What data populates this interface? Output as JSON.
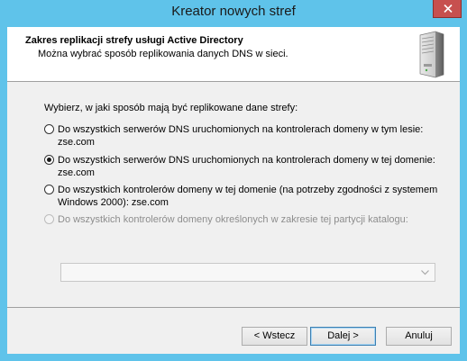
{
  "window": {
    "title": "Kreator nowych stref"
  },
  "header": {
    "title": "Zakres replikacji strefy usługi Active Directory",
    "subtitle": "Można wybrać sposób replikowania danych DNS w sieci."
  },
  "body": {
    "prompt": "Wybierz, w jaki sposób mają być replikowane dane strefy:",
    "options": [
      {
        "line1": "Do wszystkich serwerów DNS uruchomionych na kontrolerach domeny w tym lesie:",
        "line2": "zse.com",
        "selected": false,
        "disabled": false
      },
      {
        "line1": "Do wszystkich serwerów DNS uruchomionych na kontrolerach domeny w tej domenie:",
        "line2": "zse.com",
        "selected": true,
        "disabled": false
      },
      {
        "line1": "Do wszystkich kontrolerów domeny w tej domenie (na potrzeby zgodności z systemem",
        "line2": "Windows 2000): zse.com",
        "selected": false,
        "disabled": false
      },
      {
        "line1": "Do wszystkich kontrolerów domeny określonych w zakresie tej partycji katalogu:",
        "line2": "",
        "selected": false,
        "disabled": true
      }
    ],
    "partition_combo": {
      "value": ""
    }
  },
  "buttons": {
    "back": "< Wstecz",
    "next": "Dalej >",
    "cancel": "Anuluj"
  },
  "icons": {
    "header_icon": "server-icon",
    "close": "close-icon",
    "combo_arrow": "chevron-down-icon"
  }
}
